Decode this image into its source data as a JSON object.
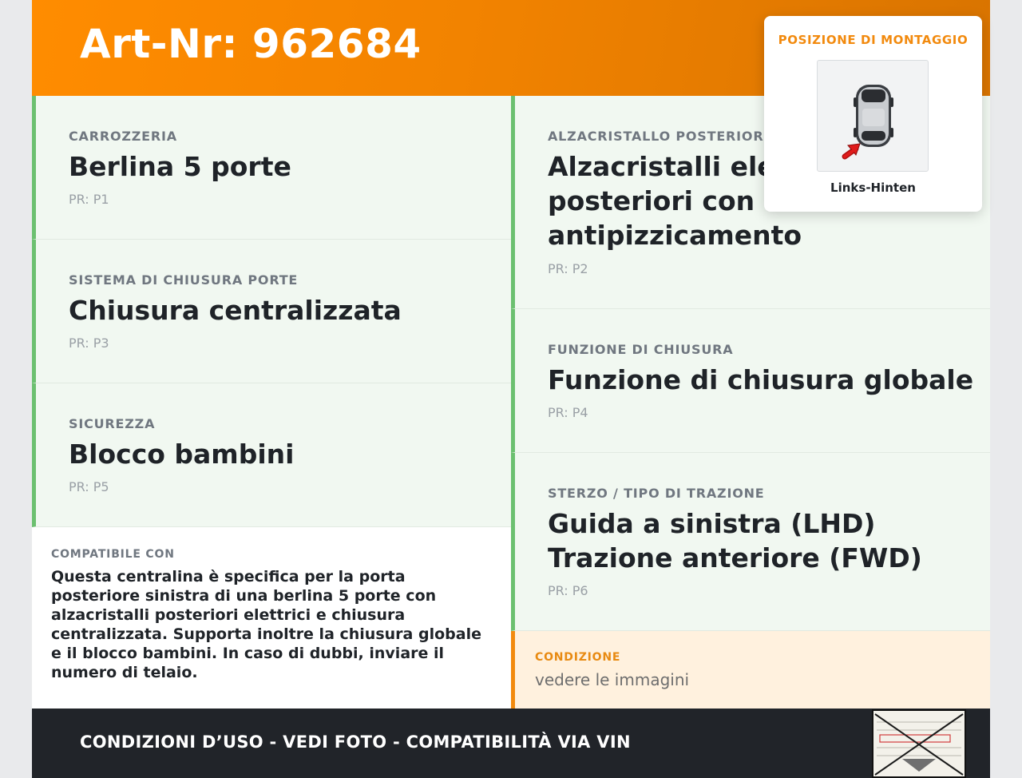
{
  "header": {
    "title": "Art-Nr: 962684"
  },
  "left_cards": [
    {
      "label": "CARROZZERIA",
      "value": "Berlina 5 porte",
      "pr": "PR: P1"
    },
    {
      "label": "SISTEMA DI CHIUSURA PORTE",
      "value": "Chiusura centralizzata",
      "pr": "PR: P3"
    },
    {
      "label": "SICUREZZA",
      "value": "Blocco bambini",
      "pr": "PR: P5"
    }
  ],
  "right_cards": [
    {
      "label": "ALZACRISTALLO POSTERIORE",
      "value_lines": [
        "Alzacristalli elettrici",
        "posteriori con funzione",
        "antipizzicamento"
      ],
      "pr": "PR: P2"
    },
    {
      "label": "FUNZIONE DI CHIUSURA",
      "value_lines": [
        "Funzione di chiusura globale"
      ],
      "pr": "PR: P4"
    },
    {
      "label": "STERZO / TIPO DI TRAZIONE",
      "value_lines": [
        "Guida a sinistra (LHD)",
        "Trazione anteriore (FWD)"
      ],
      "pr": "PR: P6"
    }
  ],
  "compat": {
    "label": "COMPATIBILE CON",
    "text": "Questa centralina è specifica per la porta posteriore sinistra di una berlina 5 porte con alzacristalli posteriori elettrici e chiusura centralizzata. Supporta inoltre la chiusura globale e il blocco bambini. In caso di dubbi, inviare il numero di telaio."
  },
  "condition": {
    "label": "CONDIZIONE",
    "value": "vedere le immagini"
  },
  "footer": {
    "text": "CONDIZIONI D’USO - VEDI FOTO - COMPATIBILITÀ VIA VIN"
  },
  "mount_popup": {
    "title": "POSIZIONE DI MONTAGGIO",
    "caption": "Links-Hinten"
  },
  "colors": {
    "accent_orange": "#ff8c00",
    "card_border_green": "#6cc070",
    "card_bg": "#f1f8f1",
    "condition_bg": "#fff1de",
    "footer_bg": "#212429"
  }
}
